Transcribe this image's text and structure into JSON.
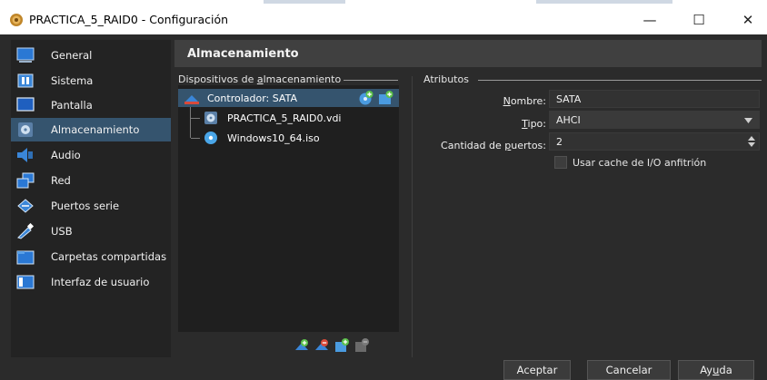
{
  "window": {
    "title": "PRACTICA_5_RAID0 - Configuración",
    "controls": {
      "minimize": "—",
      "maximize": "☐",
      "close": "✕"
    }
  },
  "sidebar": {
    "items": [
      {
        "label": "General",
        "icon": "general-icon",
        "selected": false
      },
      {
        "label": "Sistema",
        "icon": "system-icon",
        "selected": false
      },
      {
        "label": "Pantalla",
        "icon": "display-icon",
        "selected": false
      },
      {
        "label": "Almacenamiento",
        "icon": "storage-icon",
        "selected": true
      },
      {
        "label": "Audio",
        "icon": "audio-icon",
        "selected": false
      },
      {
        "label": "Red",
        "icon": "network-icon",
        "selected": false
      },
      {
        "label": "Puertos serie",
        "icon": "serial-ports-icon",
        "selected": false
      },
      {
        "label": "USB",
        "icon": "usb-icon",
        "selected": false
      },
      {
        "label": "Carpetas compartidas",
        "icon": "shared-folders-icon",
        "selected": false
      },
      {
        "label": "Interfaz de usuario",
        "icon": "user-interface-icon",
        "selected": false
      }
    ]
  },
  "main": {
    "heading": "Almacenamiento",
    "devices": {
      "label_pre": "Dispositivos de ",
      "label_mnemonic": "a",
      "label_post": "lmacenamiento",
      "controller": "Controlador: SATA",
      "items": [
        {
          "label": "PRACTICA_5_RAID0.vdi",
          "icon": "hard-disk-icon"
        },
        {
          "label": "Windows10_64.iso",
          "icon": "optical-disc-icon"
        }
      ]
    },
    "attributes": {
      "section_label": "Atributos",
      "name_label_mnemonic": "N",
      "name_label_rest": "ombre:",
      "name_value": "SATA",
      "type_label_mnemonic": "T",
      "type_label_rest": "ipo:",
      "type_value": "AHCI",
      "ports_label_pre": "Cantidad de ",
      "ports_label_mnemonic": "p",
      "ports_label_post": "uertos:",
      "ports_value": "2",
      "cache_label": "Usar cache de I/O anfitrión",
      "cache_checked": false
    }
  },
  "footer": {
    "accept": "Aceptar",
    "cancel": "Cancelar",
    "help_pre": "Ay",
    "help_mnemonic": "u",
    "help_post": "da"
  },
  "colors": {
    "selection": "#35546e",
    "background": "#2b2b2b",
    "panel": "#1f1f1f",
    "accent_green": "#5cc04a"
  }
}
